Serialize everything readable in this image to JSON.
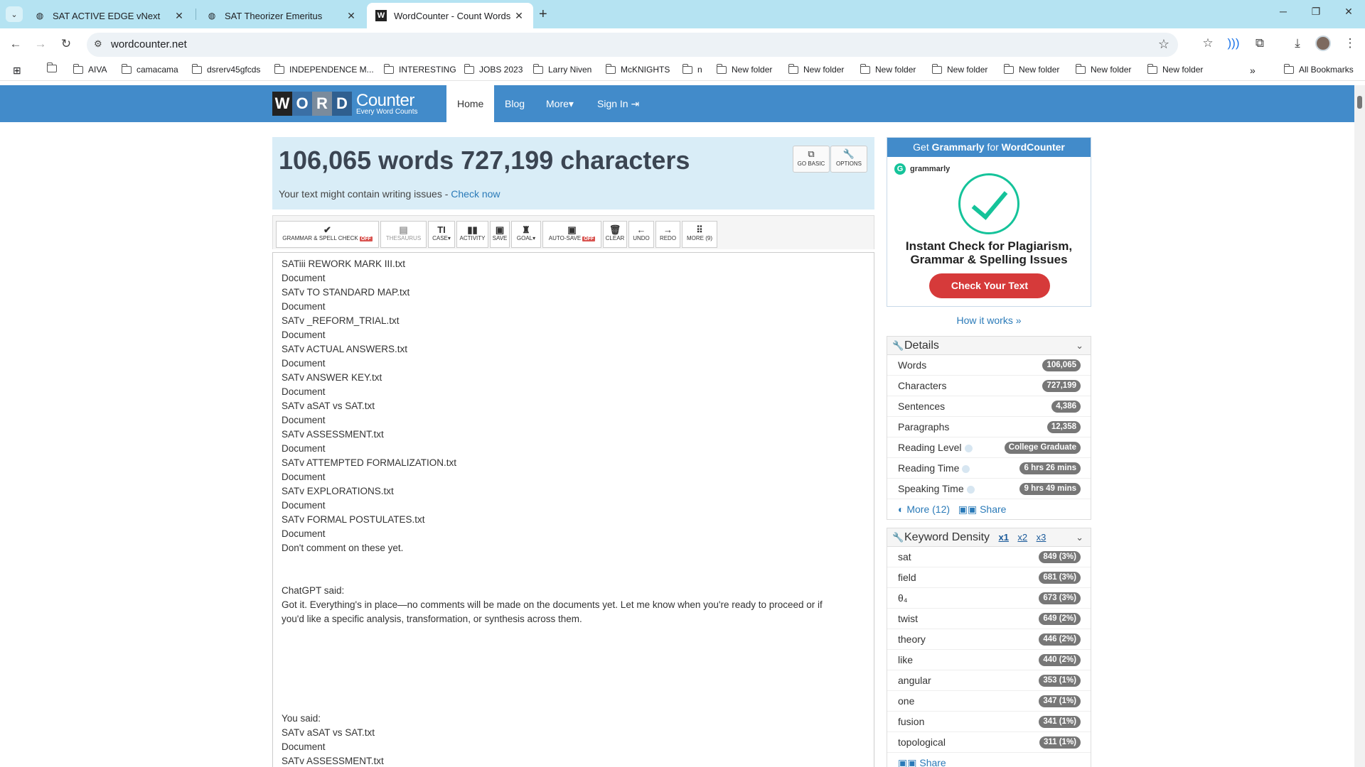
{
  "browser": {
    "tabs": [
      {
        "title": "SAT ACTIVE EDGE vNext",
        "active": false
      },
      {
        "title": "SAT Theorizer Emeritus",
        "active": false
      },
      {
        "title": "WordCounter - Count Words &",
        "active": true
      }
    ],
    "url": "wordcounter.net",
    "bookmarks": [
      "AIVA",
      "camacama",
      "dsrerv45gfcds",
      "INDEPENDENCE M...",
      "INTERESTING",
      "JOBS 2023",
      "Larry Niven",
      "McKNIGHTS",
      "n",
      "New folder",
      "New folder",
      "New folder",
      "New folder",
      "New folder",
      "New folder",
      "New folder"
    ],
    "all_bookmarks": "All Bookmarks"
  },
  "site": {
    "logo_letters": [
      "W",
      "O",
      "R",
      "D"
    ],
    "logo_counter": "Counter",
    "logo_tagline": "Every Word Counts",
    "nav": {
      "home": "Home",
      "blog": "Blog",
      "more": "More",
      "signin": "Sign In"
    }
  },
  "header": {
    "counts": "106,065 words 727,199 characters",
    "note": "Your text might contain writing issues - ",
    "check_now": "Check now",
    "go_basic": "GO BASIC",
    "options": "OPTIONS"
  },
  "toolbar": {
    "grammar": "GRAMMAR & SPELL CHECK",
    "off": "OFF",
    "thesaurus": "THESAURUS",
    "case": "CASE",
    "activity": "ACTIVITY",
    "save": "SAVE",
    "goal": "GOAL",
    "autosave": "AUTO-SAVE",
    "clear": "CLEAR",
    "undo": "UNDO",
    "redo": "REDO",
    "more": "MORE (9)"
  },
  "text_lines": [
    "SATiii REWORK MARK III.txt",
    "Document",
    "SATv TO STANDARD MAP.txt",
    "Document",
    "SATv _REFORM_TRIAL.txt",
    "Document",
    "SATv ACTUAL ANSWERS.txt",
    "Document",
    "SATv ANSWER KEY.txt",
    "Document",
    "SATv aSAT vs SAT.txt",
    "Document",
    "SATv ASSESSMENT.txt",
    "Document",
    "SATv ATTEMPTED FORMALIZATION.txt",
    "Document",
    "SATv EXPLORATIONS.txt",
    "Document",
    "SATv FORMAL POSTULATES.txt",
    "Document",
    "Don't comment on these yet.",
    "ChatGPT said:",
    "Got it. Everything's in place—no comments will be made on the documents yet. Let me know when you're ready to proceed or if",
    "you'd like a specific analysis, transformation, or synthesis across them.",
    "You said:",
    "SATv aSAT vs SAT.txt",
    "Document",
    "SATv ASSESSMENT.txt"
  ],
  "ad": {
    "head_prefix": "Get ",
    "head_grammarly": "Grammarly",
    "head_mid": " for ",
    "head_site": "WordCounter",
    "brand": "grammarly",
    "text_line1": "Instant Check for Plagiarism,",
    "text_line2": "Grammar & Spelling Issues",
    "button": "Check Your Text",
    "how": "How it works »"
  },
  "details": {
    "title": "Details",
    "rows": [
      {
        "label": "Words",
        "value": "106,065"
      },
      {
        "label": "Characters",
        "value": "727,199"
      },
      {
        "label": "Sentences",
        "value": "4,386"
      },
      {
        "label": "Paragraphs",
        "value": "12,358"
      },
      {
        "label": "Reading Level",
        "value": "College Graduate"
      },
      {
        "label": "Reading Time",
        "value": "6 hrs 26 mins"
      },
      {
        "label": "Speaking Time",
        "value": "9 hrs 49 mins"
      }
    ],
    "more": "More (12)",
    "share": "Share"
  },
  "keywords": {
    "title": "Keyword Density",
    "tabs": [
      "x1",
      "x2",
      "x3"
    ],
    "rows": [
      {
        "word": "sat",
        "value": "849 (3%)"
      },
      {
        "word": "field",
        "value": "681 (3%)"
      },
      {
        "word": "θ₄",
        "value": "673 (3%)"
      },
      {
        "word": "twist",
        "value": "649 (2%)"
      },
      {
        "word": "theory",
        "value": "446 (2%)"
      },
      {
        "word": "like",
        "value": "440 (2%)"
      },
      {
        "word": "angular",
        "value": "353 (1%)"
      },
      {
        "word": "one",
        "value": "347 (1%)"
      },
      {
        "word": "fusion",
        "value": "341 (1%)"
      },
      {
        "word": "topological",
        "value": "311 (1%)"
      }
    ],
    "share": "Share"
  },
  "colors": {
    "brand_blue": "#428bca",
    "light_blue": "#d9edf7",
    "grammarly_green": "#15c39a",
    "ad_button": "#d63a3a"
  }
}
